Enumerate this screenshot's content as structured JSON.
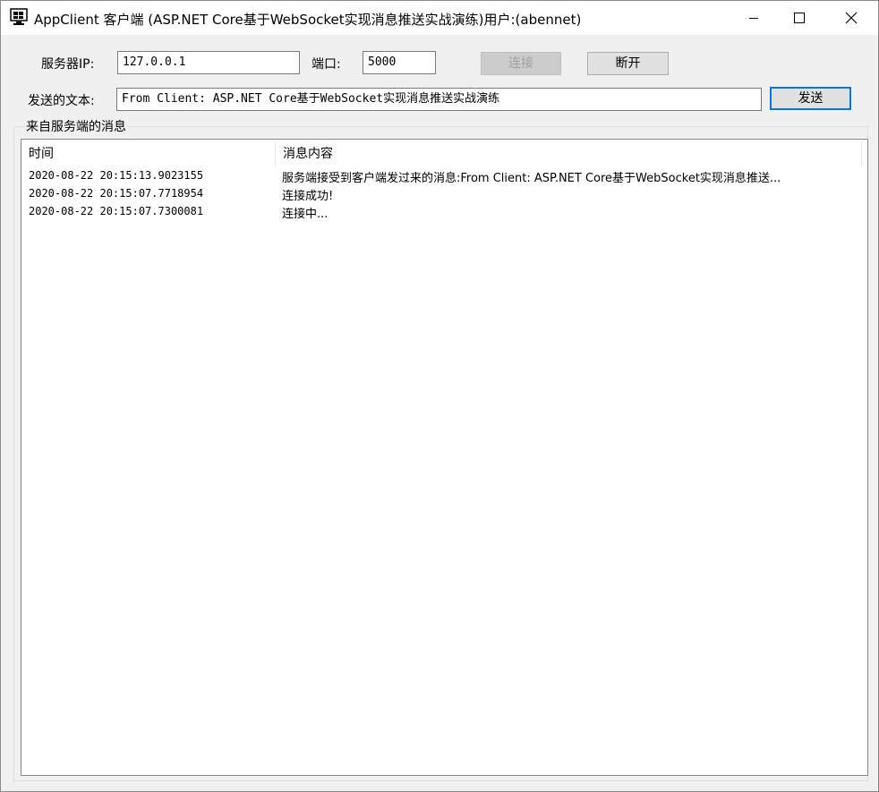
{
  "window": {
    "title": "AppClient 客户端 (ASP.NET Core基于WebSocket实现消息推送实战演练)用户:(abennet)",
    "icons": {
      "app": "monitor-app-icon",
      "minimize": "minimize-icon",
      "maximize": "maximize-icon",
      "close": "close-icon"
    }
  },
  "connection": {
    "ip_label": "服务器IP:",
    "ip_value": "127.0.0.1",
    "port_label": "端口:",
    "port_value": "5000",
    "connect_label": "连接",
    "disconnect_label": "断开"
  },
  "send": {
    "label": "发送的文本:",
    "value": "From Client: ASP.NET Core基于WebSocket实现消息推送实战演练",
    "button_label": "发送"
  },
  "messages": {
    "group_title": "来自服务端的消息",
    "columns": [
      "时间",
      "消息内容"
    ],
    "rows": [
      {
        "time": "2020-08-22 20:15:13.9023155",
        "content": "服务端接受到客户端发过来的消息:From Client: ASP.NET Core基于WebSocket实现消息推送..."
      },
      {
        "time": "2020-08-22 20:15:07.7718954",
        "content": "连接成功!"
      },
      {
        "time": "2020-08-22 20:15:07.7300081",
        "content": "连接中..."
      }
    ]
  },
  "colors": {
    "accent": "#0078d7",
    "window_bg": "#f0f0f0",
    "titlebar_bg": "#ffffff"
  }
}
